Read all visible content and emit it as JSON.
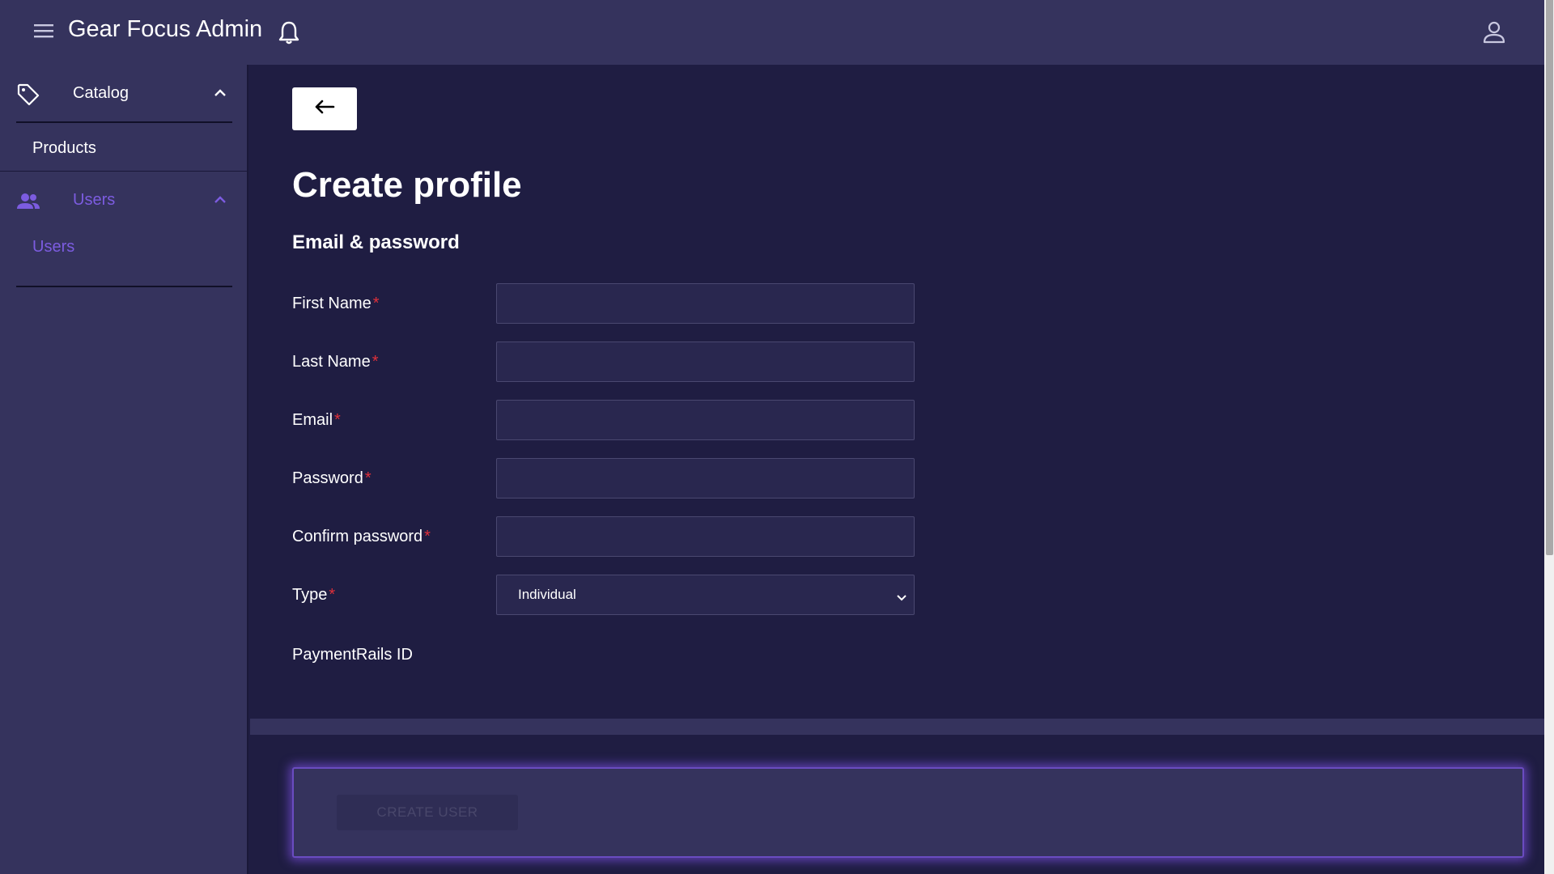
{
  "header": {
    "title": "Gear Focus Admin",
    "menu_icon": "hamburger-menu-icon",
    "notification_icon": "bell-icon",
    "account_icon": "user-icon"
  },
  "sidebar": {
    "sections": [
      {
        "label": "Catalog",
        "icon": "tag-icon",
        "expanded": true,
        "items": [
          {
            "label": "Products"
          }
        ]
      },
      {
        "label": "Users",
        "icon": "users-icon",
        "expanded": true,
        "active": true,
        "items": [
          {
            "label": "Users",
            "active": true
          }
        ]
      }
    ]
  },
  "main": {
    "back_icon": "arrow-left-icon",
    "page_title": "Create profile",
    "section_title": "Email & password",
    "fields": [
      {
        "label": "First Name",
        "required_mark": "*",
        "value": ""
      },
      {
        "label": "Last Name",
        "required_mark": "*",
        "value": ""
      },
      {
        "label": "Email",
        "required_mark": "*",
        "value": ""
      },
      {
        "label": "Password",
        "required_mark": "*",
        "value": ""
      },
      {
        "label": "Confirm password",
        "required_mark": "*",
        "value": ""
      }
    ],
    "type_field": {
      "label": "Type",
      "required_mark": "*",
      "selected": "Individual"
    },
    "paymentrails_label": "PaymentRails ID",
    "create_button_label": "CREATE USER"
  },
  "colors": {
    "background": "#1f1d42",
    "panel": "#35335d",
    "accent_purple": "#7c5ce0",
    "required_red": "#e0303a"
  }
}
